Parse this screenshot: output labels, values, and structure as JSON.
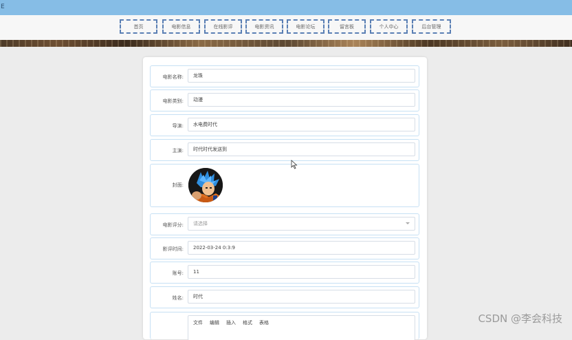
{
  "window": {
    "title_char": "E"
  },
  "nav": {
    "items": [
      {
        "label": "首页"
      },
      {
        "label": "电影信息"
      },
      {
        "label": "在线影评"
      },
      {
        "label": "电影资讯"
      },
      {
        "label": "电影论坛"
      },
      {
        "label": "留言板"
      },
      {
        "label": "个人中心"
      },
      {
        "label": "后台管理"
      }
    ]
  },
  "form": {
    "name_label": "电影名称:",
    "name_value": "龙珠",
    "category_label": "电影类别:",
    "category_value": "动漫",
    "director_label": "导演:",
    "director_value": "水电费时代",
    "cast_label": "主演:",
    "cast_value": "时代时代发送到",
    "cover_label": "封面:",
    "rating_label": "电影评分:",
    "rating_placeholder": "请选择",
    "review_time_label": "影评时间:",
    "review_time_value": "2022-03-24 0:3:9",
    "account_label": "账号:",
    "account_value": "11",
    "realname_label": "姓名:",
    "realname_value": "时代",
    "editor_menu": [
      "文件",
      "编辑",
      "插入",
      "格式",
      "表格"
    ]
  },
  "watermark": "CSDN @李会科技",
  "colors": {
    "topbar": "#86bde6",
    "nav_border": "#5a7fb4",
    "row_border": "#c6e0f4"
  }
}
